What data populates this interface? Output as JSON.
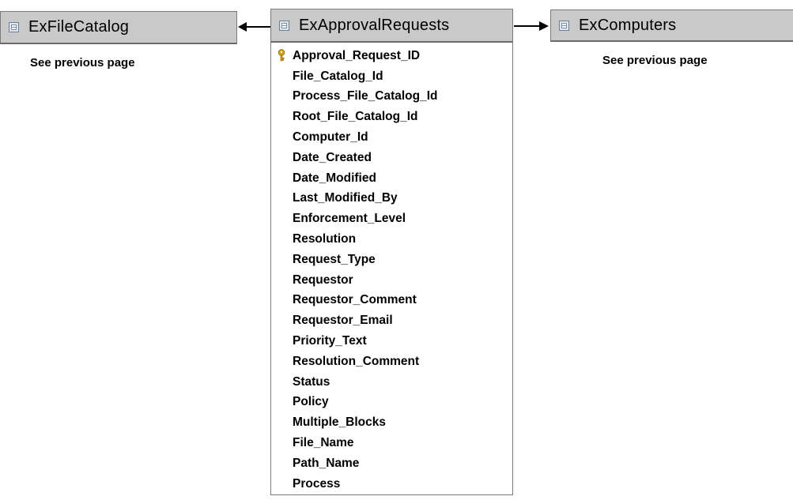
{
  "tables": {
    "left": {
      "name": "ExFileCatalog",
      "note": "See previous page",
      "icon": "table-icon"
    },
    "center": {
      "name": "ExApprovalRequests",
      "icon": "table-icon",
      "columns": [
        {
          "label": "Approval_Request_ID",
          "primary_key": true
        },
        {
          "label": "File_Catalog_Id"
        },
        {
          "label": "Process_File_Catalog_Id"
        },
        {
          "label": "Root_File_Catalog_Id"
        },
        {
          "label": "Computer_Id"
        },
        {
          "label": "Date_Created"
        },
        {
          "label": "Date_Modified"
        },
        {
          "label": "Last_Modified_By"
        },
        {
          "label": "Enforcement_Level"
        },
        {
          "label": "Resolution"
        },
        {
          "label": "Request_Type"
        },
        {
          "label": "Requestor"
        },
        {
          "label": "Requestor_Comment"
        },
        {
          "label": "Requestor_Email"
        },
        {
          "label": "Priority_Text"
        },
        {
          "label": "Resolution_Comment"
        },
        {
          "label": "Status"
        },
        {
          "label": "Policy"
        },
        {
          "label": "Multiple_Blocks"
        },
        {
          "label": "File_Name"
        },
        {
          "label": "Path_Name"
        },
        {
          "label": "Process"
        }
      ]
    },
    "right": {
      "name": "ExComputers",
      "note": "See previous page",
      "icon": "table-icon"
    }
  },
  "relations": [
    {
      "from": "ExApprovalRequests",
      "to": "ExFileCatalog"
    },
    {
      "from": "ExApprovalRequests",
      "to": "ExComputers"
    }
  ],
  "colors": {
    "header_bg": "#c9c9c9",
    "border": "#7a7a7a",
    "key_icon": "#d9a400"
  }
}
